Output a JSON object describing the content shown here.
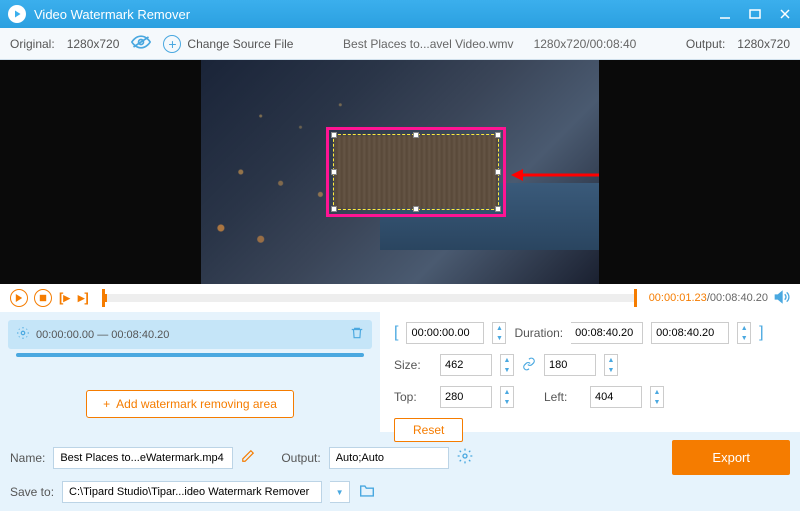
{
  "titlebar": {
    "title": "Video Watermark Remover"
  },
  "toolbar": {
    "original_label": "Original:",
    "original_value": "1280x720",
    "change_source": "Change Source File",
    "filename": "Best Places to...avel Video.wmv",
    "file_res_time": "1280x720/00:08:40",
    "output_label": "Output:",
    "output_value": "1280x720"
  },
  "playback": {
    "current": "00:00:01.23",
    "total": "00:08:40.20"
  },
  "segment": {
    "start": "00:00:00.00",
    "sep": "—",
    "end": "00:08:40.20"
  },
  "add_area_label": "Add watermark removing area",
  "controls": {
    "time_start": "00:00:00.00",
    "duration_label": "Duration:",
    "duration": "00:08:40.20",
    "time_end": "00:08:40.20",
    "size_label": "Size:",
    "width": "462",
    "height": "180",
    "top_label": "Top:",
    "top": "280",
    "left_label": "Left:",
    "left": "404",
    "reset": "Reset"
  },
  "bottom": {
    "name_label": "Name:",
    "name_value": "Best Places to...eWatermark.mp4",
    "output_label": "Output:",
    "output_value": "Auto;Auto",
    "saveto_label": "Save to:",
    "saveto_value": "C:\\Tipard Studio\\Tipar...ideo Watermark Remover",
    "export": "Export"
  }
}
